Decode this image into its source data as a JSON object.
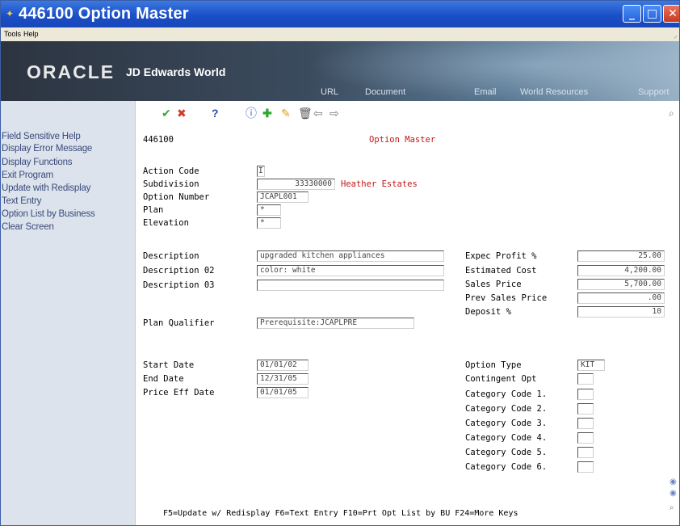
{
  "window": {
    "title": "446100  Option Master",
    "buttons": {
      "minimize": "_",
      "maximize": "□",
      "close": "✕"
    }
  },
  "menubar": {
    "items": [
      "Tools",
      "Help"
    ]
  },
  "banner": {
    "oracle": "ORACLE",
    "product": "JD Edwards World",
    "links": [
      "URL",
      "Document",
      "Email",
      "World Resources",
      "Support"
    ]
  },
  "leftmenu": {
    "items": [
      "Field Sensitive Help",
      "Display Error Message",
      "Display Functions",
      "Exit Program",
      "Update with Redisplay",
      "Text Entry",
      "Option List by Business",
      "Clear Screen"
    ]
  },
  "toolbar": {
    "icons": [
      "check-icon",
      "cancel-icon",
      "help-icon",
      "info-icon",
      "add-icon",
      "edit-icon",
      "delete-icon",
      "prev-icon",
      "next-icon",
      "search-icon"
    ]
  },
  "form": {
    "program_id": "446100",
    "title": "Option Master",
    "action_code_label": "Action Code",
    "action_code": "I",
    "subdivision_label": "Subdivision",
    "subdivision": "33330000",
    "subdivision_name": "Heather Estates",
    "option_number_label": "Option Number",
    "option_number": "JCAPL001",
    "plan_label": "Plan",
    "plan": "*",
    "elevation_label": "Elevation",
    "elevation": "*",
    "description_label": "Description",
    "description": "upgraded kitchen appliances",
    "description02_label": "Description 02",
    "description02": "color: white",
    "description03_label": "Description 03",
    "description03": "",
    "plan_qualifier_label": "Plan Qualifier",
    "plan_qualifier": "Prerequisite:JCAPLPRE",
    "start_date_label": "Start Date",
    "start_date": "01/01/02",
    "end_date_label": "End Date",
    "end_date": "12/31/05",
    "price_eff_date_label": "Price Eff Date",
    "price_eff_date": "01/01/05",
    "expec_profit_label": "Expec Profit %",
    "expec_profit": "25.00",
    "estimated_cost_label": "Estimated Cost",
    "estimated_cost": "4,200.00",
    "sales_price_label": "Sales Price",
    "sales_price": "5,700.00",
    "prev_sales_price_label": "Prev Sales Price",
    "prev_sales_price": ".00",
    "deposit_label": "Deposit %",
    "deposit": "10",
    "option_type_label": "Option Type",
    "option_type": "KIT",
    "contingent_opt_label": "Contingent Opt",
    "contingent_opt": "",
    "category_codes": [
      {
        "label": "Category Code 1.",
        "value": ""
      },
      {
        "label": "Category Code 2.",
        "value": ""
      },
      {
        "label": "Category Code 3.",
        "value": ""
      },
      {
        "label": "Category Code 4.",
        "value": ""
      },
      {
        "label": "Category Code 5.",
        "value": ""
      },
      {
        "label": "Category Code 6.",
        "value": ""
      }
    ],
    "function_keys": "F5=Update w/ Redisplay  F6=Text Entry  F10=Prt Opt List by BU F24=More Keys"
  }
}
